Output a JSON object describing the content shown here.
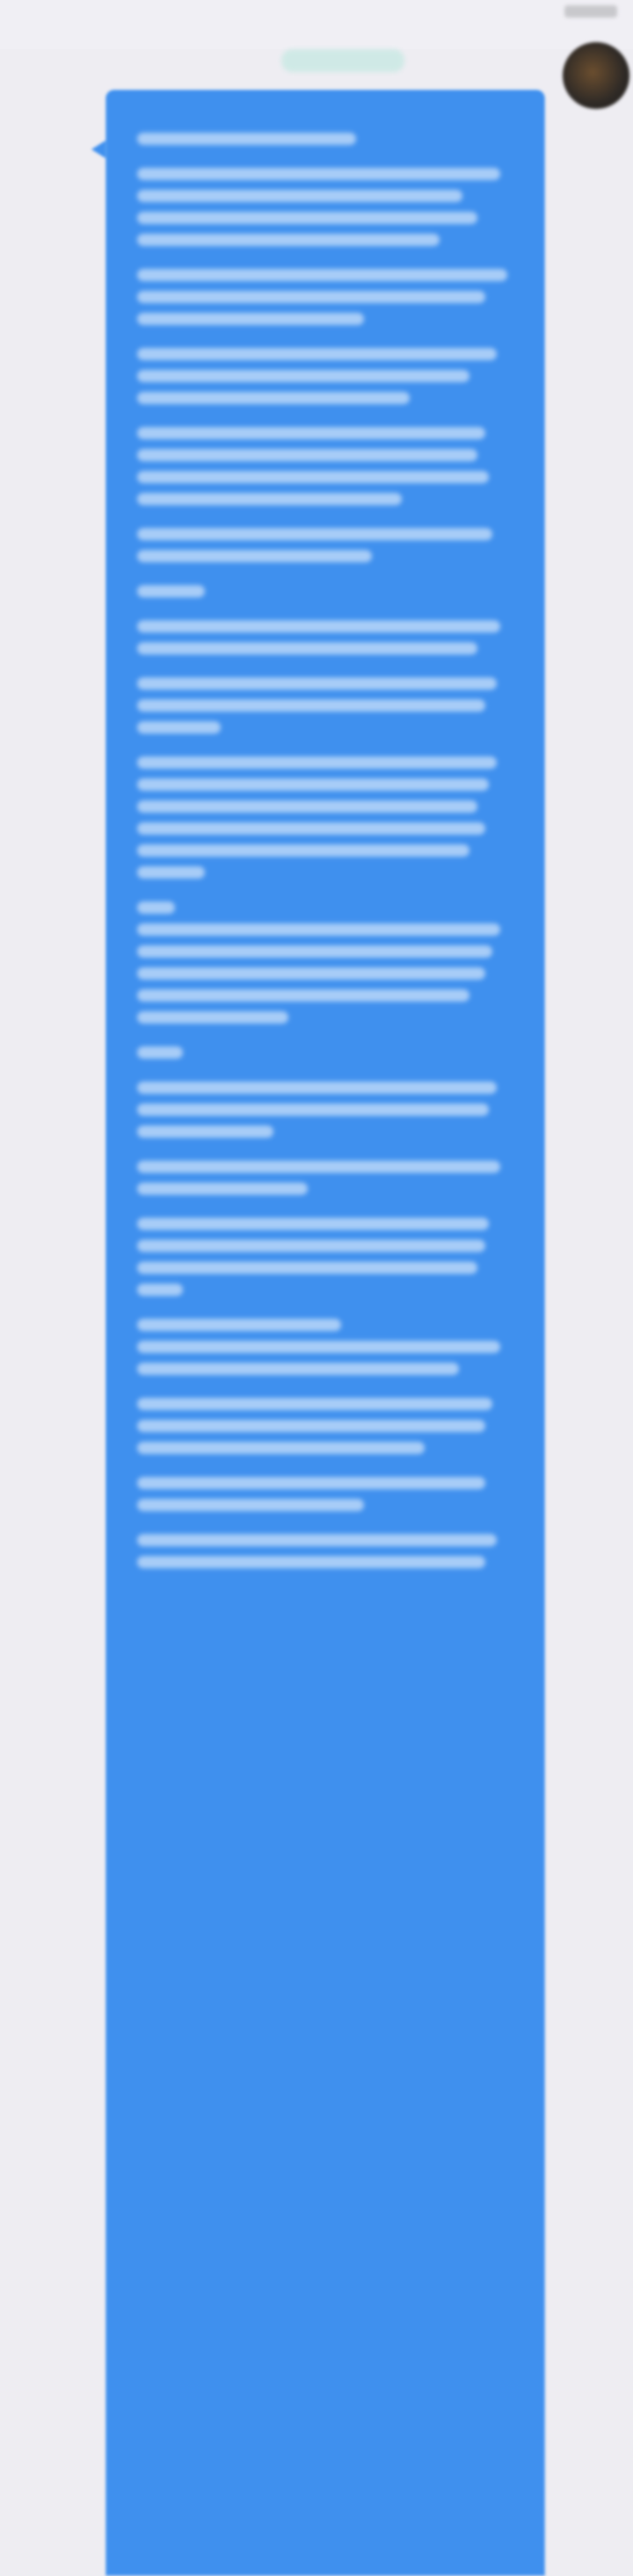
{
  "header": {
    "title": "",
    "right_text": ""
  },
  "meta": {
    "pill_text": ""
  },
  "message": {
    "paragraphs": [
      {
        "text": ""
      },
      {
        "text": ""
      },
      {
        "text": ""
      },
      {
        "text": ""
      },
      {
        "text": ""
      },
      {
        "text": ""
      },
      {
        "text": ""
      },
      {
        "text": ""
      },
      {
        "text": ""
      },
      {
        "text": ""
      },
      {
        "text": ""
      },
      {
        "text": ""
      },
      {
        "text": ""
      },
      {
        "text": ""
      },
      {
        "text": ""
      },
      {
        "text": ""
      },
      {
        "text": ""
      },
      {
        "text": ""
      },
      {
        "text": ""
      }
    ]
  },
  "colors": {
    "background": "#eeedf2",
    "bubble": "#3f90ee",
    "meta_pill": "#bfe8e0"
  },
  "icons": {
    "avatar": "avatar-image"
  }
}
